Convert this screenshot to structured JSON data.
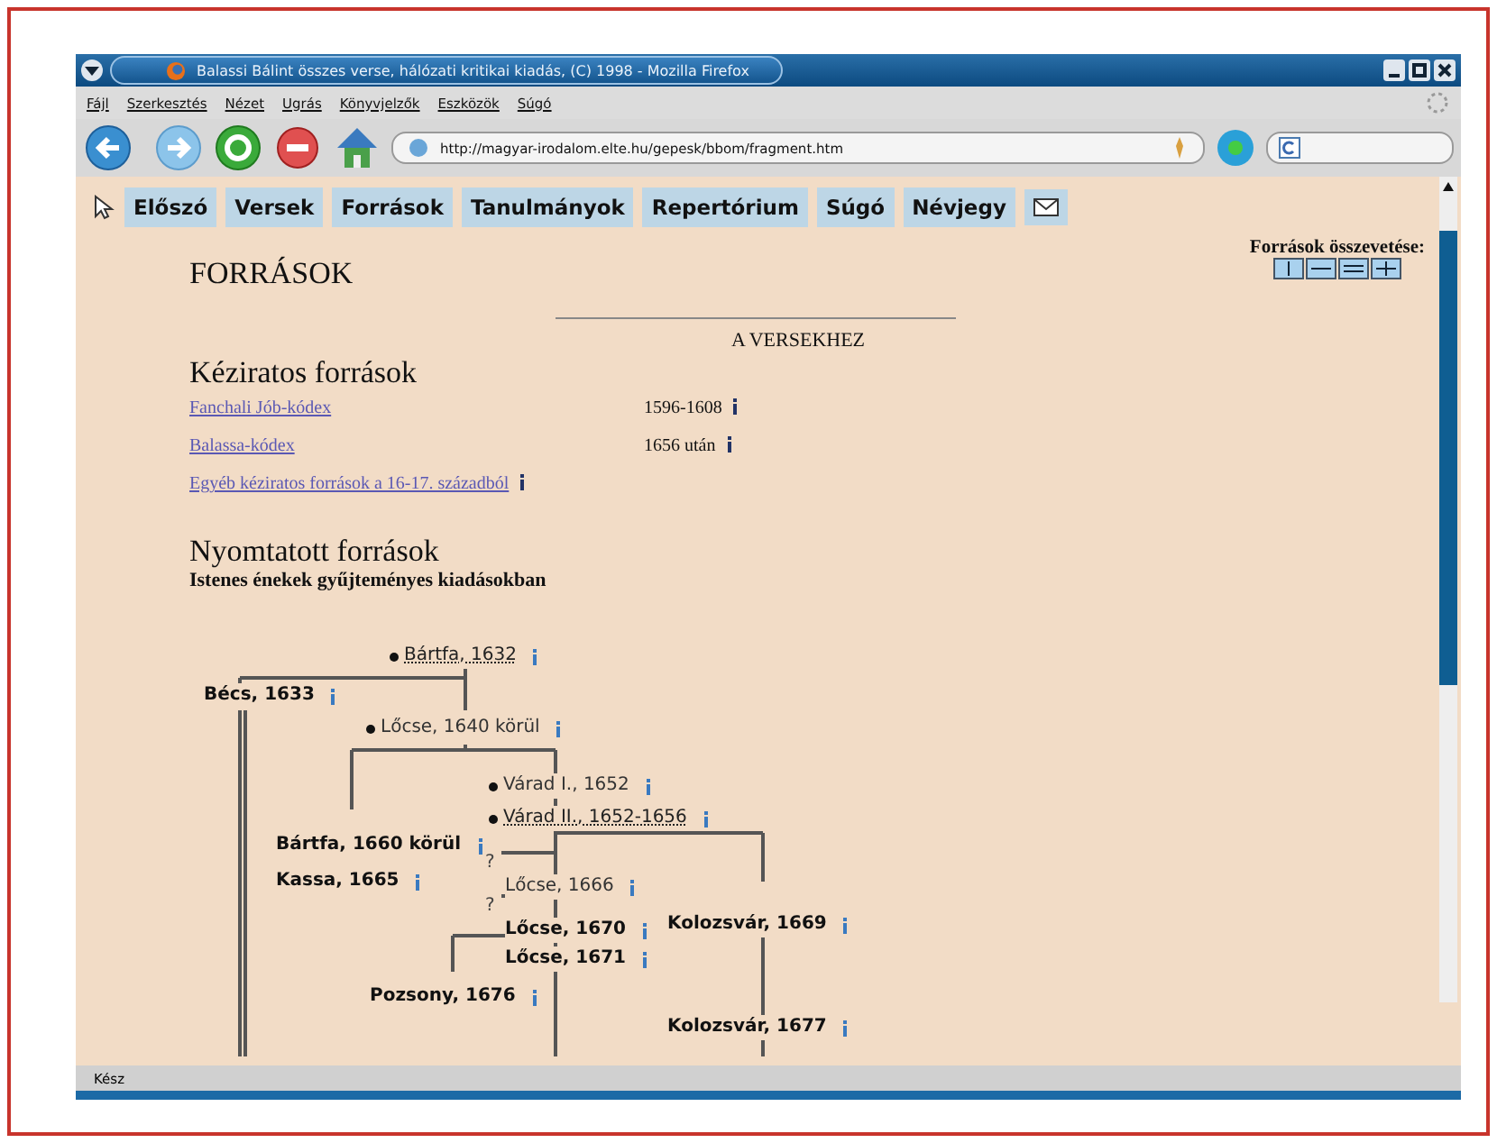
{
  "window": {
    "title": "Balassi Bálint összes verse, hálózati kritikai kiadás, (C) 1998 - Mozilla Firefox"
  },
  "menu": [
    "Fájl",
    "Szerkesztés",
    "Nézet",
    "Ugrás",
    "Könyvjelzők",
    "Eszközök",
    "Súgó"
  ],
  "address": {
    "value": "http://magyar-irodalom.elte.hu/gepesk/bbom/fragment.htm"
  },
  "nav": [
    "Előszó",
    "Versek",
    "Források",
    "Tanulmányok",
    "Repertórium",
    "Súgó",
    "Névjegy"
  ],
  "page": {
    "title": "FORRÁSOK",
    "compare_label": "Források összevetése:",
    "section": "A VERSEKHEZ",
    "manuscripts_heading": "Kéziratos források",
    "manuscripts": [
      {
        "label": "Fanchali Jób-kódex",
        "date": "1596-1608"
      },
      {
        "label": "Balassa-kódex",
        "date": "1656 után"
      },
      {
        "label": "Egyéb kéziratos források a 16-17. századból"
      }
    ],
    "printed_heading": "Nyomtatott források",
    "printed_subheading": "Istenes énekek gyűjteményes kiadásokban"
  },
  "tree": [
    {
      "label": "Bártfa, 1632",
      "kind": "link",
      "bullet": true
    },
    {
      "label": "Bécs, 1633",
      "kind": "bold",
      "bullet": false
    },
    {
      "label": "Lőcse, 1640 körül",
      "kind": "plain",
      "bullet": true
    },
    {
      "label": "Várad I., 1652",
      "kind": "plain",
      "bullet": true
    },
    {
      "label": "Várad II., 1652-1656",
      "kind": "link",
      "bullet": true
    },
    {
      "label": "Bártfa, 1660 körül",
      "kind": "bold",
      "bullet": false
    },
    {
      "label": "Kassa, 1665",
      "kind": "bold",
      "bullet": false
    },
    {
      "label": "Lőcse, 1666",
      "kind": "plain",
      "bullet": false
    },
    {
      "label": "Lőcse, 1670",
      "kind": "bold",
      "bullet": false
    },
    {
      "label": "Lőcse, 1671",
      "kind": "bold",
      "bullet": false
    },
    {
      "label": "Kolozsvár, 1669",
      "kind": "bold",
      "bullet": false
    },
    {
      "label": "Pozsony, 1676",
      "kind": "bold",
      "bullet": false
    },
    {
      "label": "Kolozsvár, 1677",
      "kind": "bold",
      "bullet": false
    }
  ],
  "tree_marks": [
    "?",
    "?"
  ],
  "status_bar": "Kész"
}
